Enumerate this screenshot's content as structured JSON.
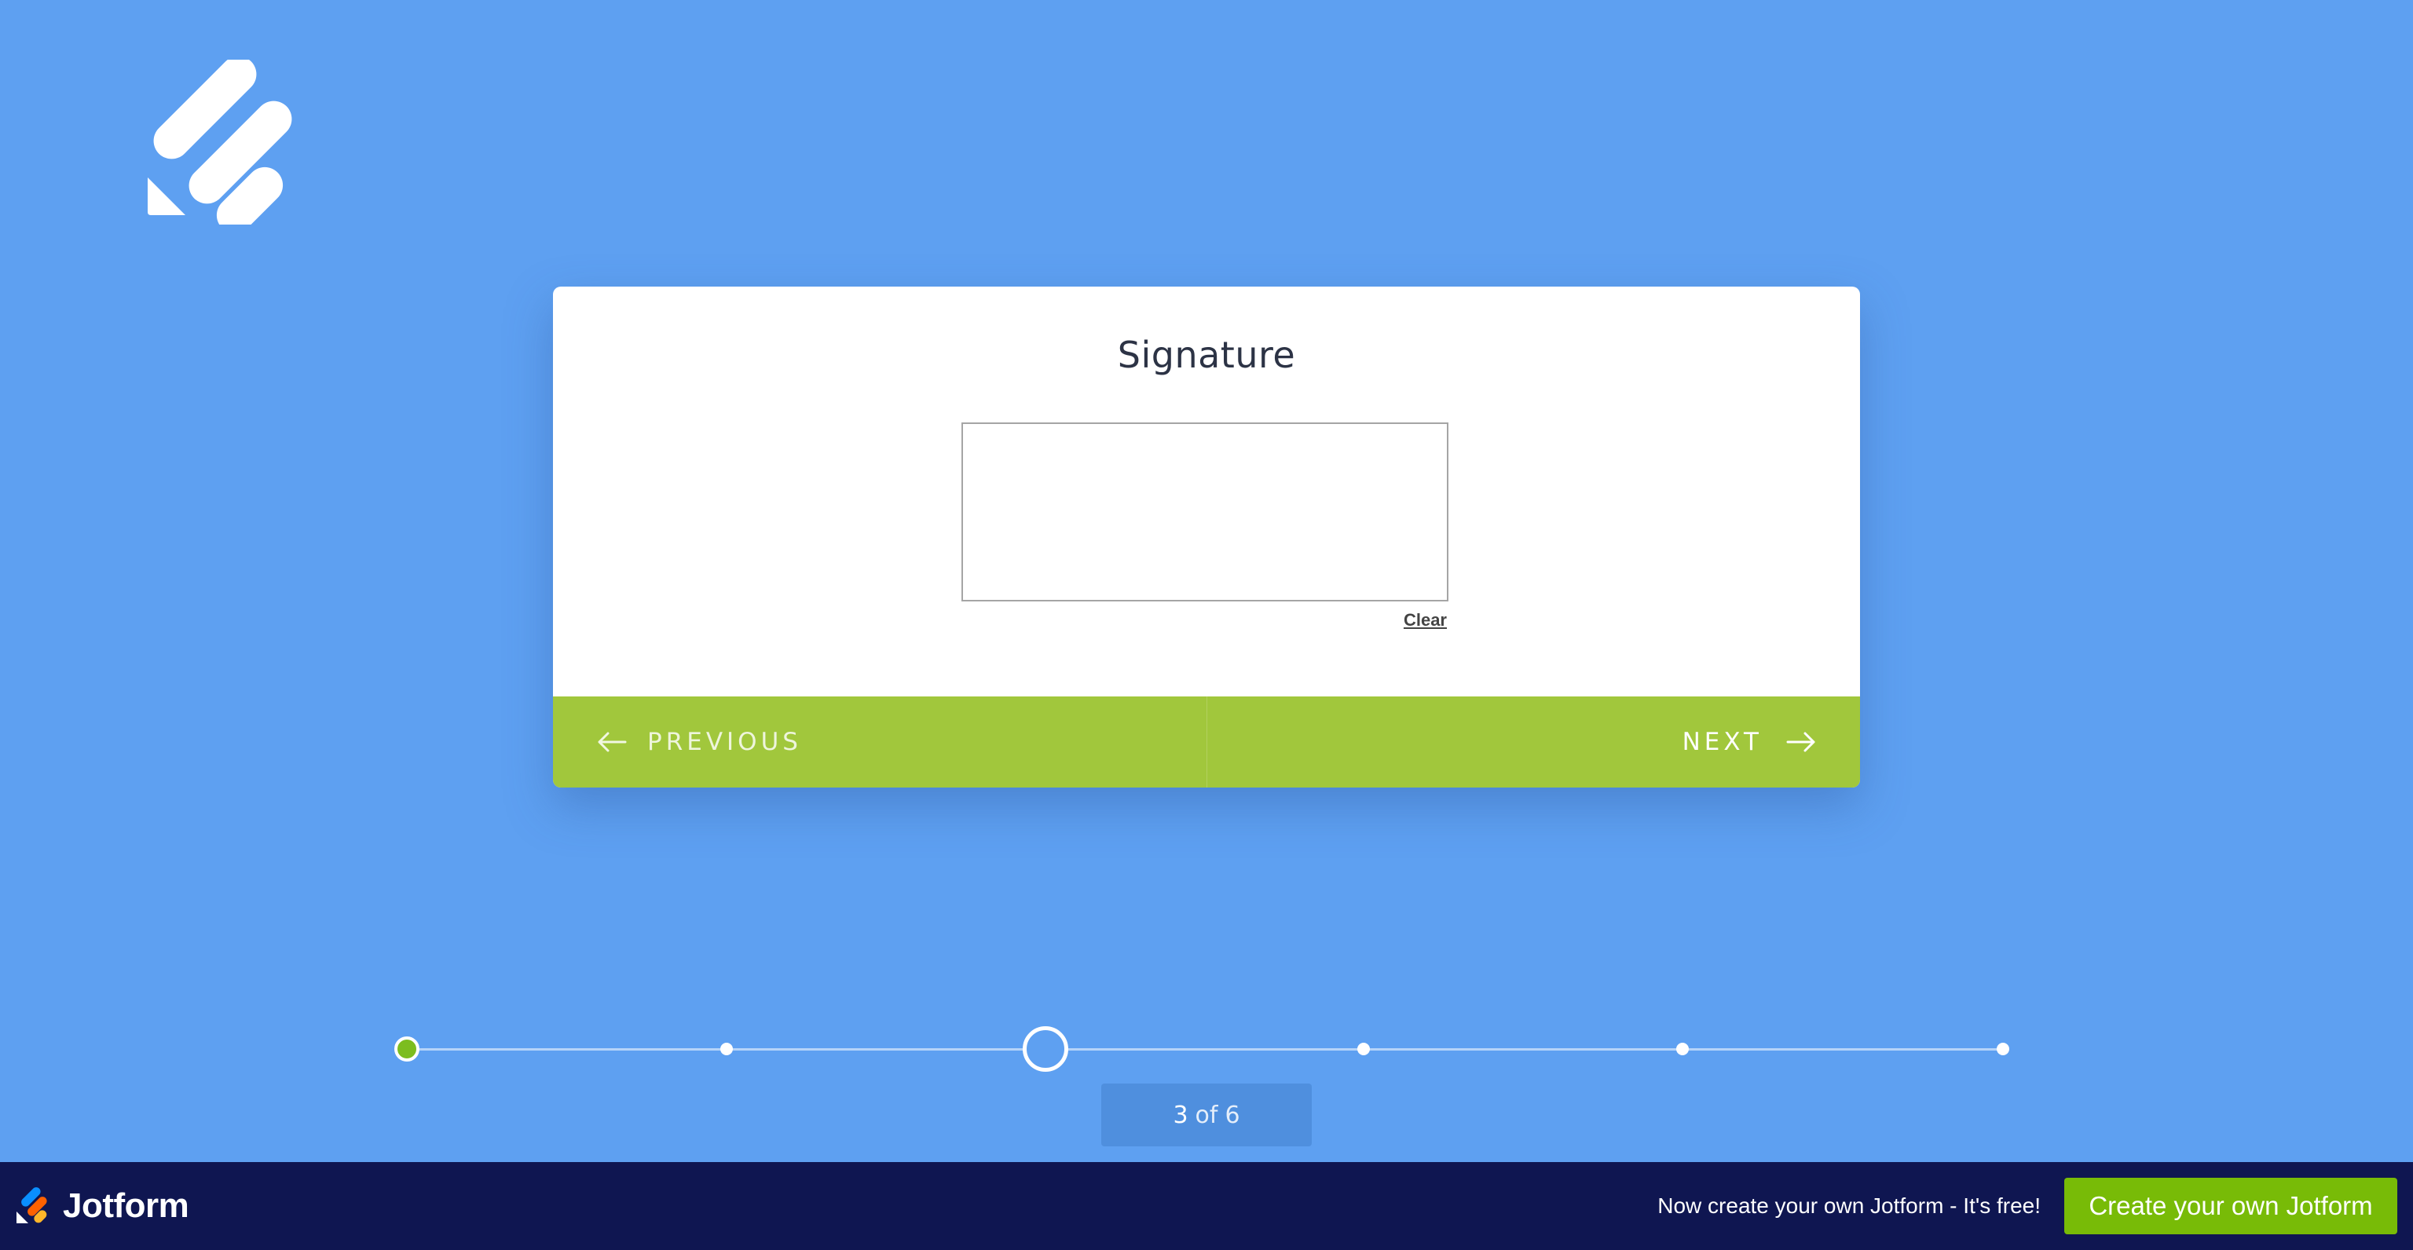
{
  "colors": {
    "background": "#5ea0f1",
    "accent_green": "#a1c73c",
    "footer_bg": "#0f1651",
    "cta_green": "#78bb07",
    "step_done": "#7cbd1f"
  },
  "logo": {
    "icon": "form-logo-icon"
  },
  "card": {
    "title": "Signature",
    "clear_label": "Clear",
    "previous_label": "PREVIOUS",
    "next_label": "NEXT",
    "previous_icon": "arrow-left-icon",
    "next_icon": "arrow-right-icon"
  },
  "progress": {
    "current": "3",
    "of_label": "of",
    "total": "6",
    "completed_steps": 1
  },
  "footer": {
    "brand": "Jotform",
    "brand_icon": "jotform-logo-icon",
    "tagline": "Now create your own Jotform - It's free!",
    "cta_label": "Create your own Jotform"
  }
}
